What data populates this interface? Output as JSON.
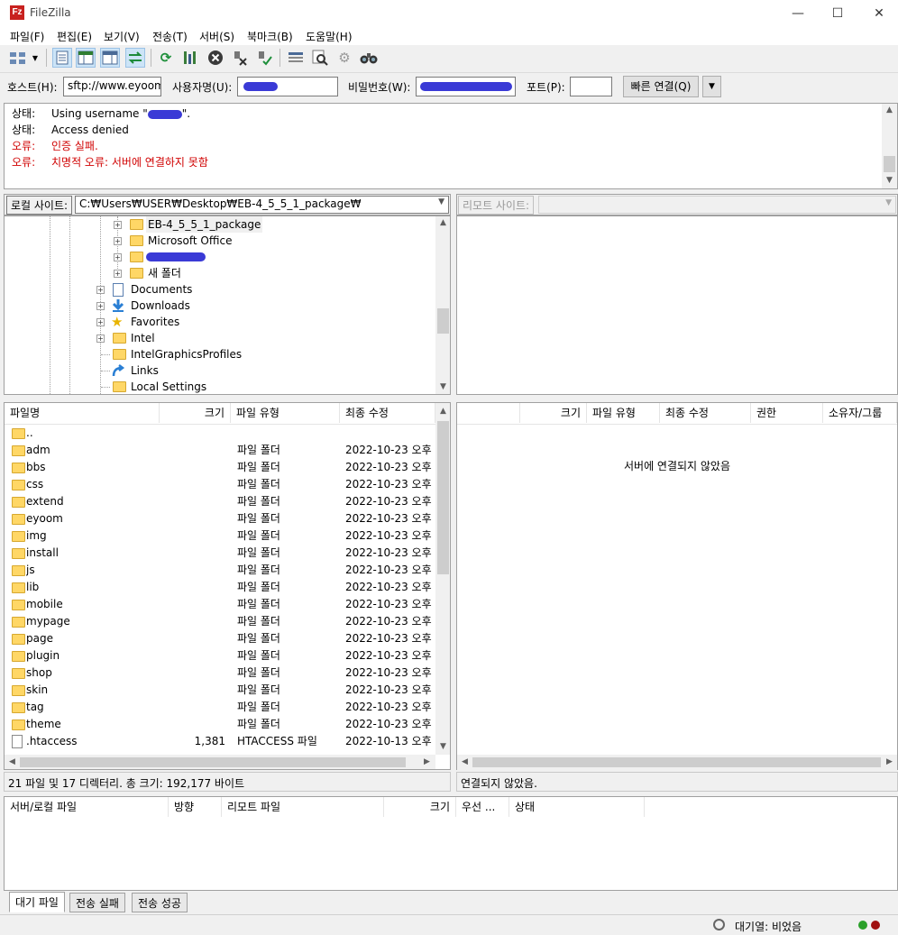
{
  "window": {
    "title": "FileZilla",
    "app_icon_label": "Fz",
    "minimize_glyph": "—",
    "maximize_glyph": "☐",
    "close_glyph": "✕"
  },
  "menu": [
    "파일(F)",
    "편집(E)",
    "보기(V)",
    "전송(T)",
    "서버(S)",
    "북마크(B)",
    "도움말(H)"
  ],
  "toolbar": {
    "icons": [
      "site-manager-icon",
      "chevron-down-icon",
      "message-log-toggle-icon",
      "local-tree-toggle-icon",
      "remote-tree-toggle-icon",
      "transfer-queue-toggle-icon",
      "refresh-icon",
      "process-queue-icon",
      "cancel-icon",
      "disconnect-icon",
      "reconnect-icon",
      "filter-icon",
      "compare-icon",
      "sync-browse-icon",
      "search-icon"
    ]
  },
  "quickconnect": {
    "host_label": "호스트(H):",
    "host_value": "sftp://www.eyoom",
    "user_label": "사용자명(U):",
    "pass_label": "비밀번호(W):",
    "port_label": "포트(P):",
    "port_value": "",
    "connect_label": "빠른 연결(Q)",
    "dropdown_glyph": "▼"
  },
  "log": [
    {
      "label": "상태:",
      "text": "Using username \"",
      "suffix": "\".",
      "type": "status"
    },
    {
      "label": "상태:",
      "text": "Access denied",
      "suffix": "",
      "type": "status"
    },
    {
      "label": "오류:",
      "text": "인증 실패.",
      "suffix": "",
      "type": "error"
    },
    {
      "label": "오류:",
      "text": "치명적 오류: 서버에 연결하지 못함",
      "suffix": "",
      "type": "error"
    }
  ],
  "local": {
    "site_label": "로컬 사이트:",
    "path": "C:₩Users₩USER₩Desktop₩EB-4_5_5_1_package₩",
    "tree": [
      {
        "label": "EB-4_5_5_1_package",
        "level": 2,
        "icon": "folder",
        "selected": true
      },
      {
        "label": "Microsoft Office",
        "level": 2,
        "icon": "folder"
      },
      {
        "label": "",
        "level": 2,
        "icon": "folder",
        "redacted": true
      },
      {
        "label": "새 폴더",
        "level": 2,
        "icon": "folder"
      },
      {
        "label": "Documents",
        "level": 1,
        "icon": "documents"
      },
      {
        "label": "Downloads",
        "level": 1,
        "icon": "downloads"
      },
      {
        "label": "Favorites",
        "level": 1,
        "icon": "favorites"
      },
      {
        "label": "Intel",
        "level": 1,
        "icon": "folder"
      },
      {
        "label": "IntelGraphicsProfiles",
        "level": 1,
        "icon": "folder",
        "no_expander": true
      },
      {
        "label": "Links",
        "level": 1,
        "icon": "links",
        "no_expander": true
      },
      {
        "label": "Local Settings",
        "level": 1,
        "icon": "folder",
        "no_expander": true
      }
    ],
    "columns": [
      "파일명",
      "크기",
      "파일 유형",
      "최종 수정"
    ],
    "files": [
      {
        "name": "..",
        "size": "",
        "type": "",
        "modified": "",
        "icon": "folder"
      },
      {
        "name": "adm",
        "size": "",
        "type": "파일 폴더",
        "modified": "2022-10-23 오후 ..",
        "icon": "folder"
      },
      {
        "name": "bbs",
        "size": "",
        "type": "파일 폴더",
        "modified": "2022-10-23 오후 ..",
        "icon": "folder"
      },
      {
        "name": "css",
        "size": "",
        "type": "파일 폴더",
        "modified": "2022-10-23 오후 ..",
        "icon": "folder"
      },
      {
        "name": "extend",
        "size": "",
        "type": "파일 폴더",
        "modified": "2022-10-23 오후 ..",
        "icon": "folder"
      },
      {
        "name": "eyoom",
        "size": "",
        "type": "파일 폴더",
        "modified": "2022-10-23 오후 ..",
        "icon": "folder"
      },
      {
        "name": "img",
        "size": "",
        "type": "파일 폴더",
        "modified": "2022-10-23 오후 ..",
        "icon": "folder"
      },
      {
        "name": "install",
        "size": "",
        "type": "파일 폴더",
        "modified": "2022-10-23 오후 ..",
        "icon": "folder"
      },
      {
        "name": "js",
        "size": "",
        "type": "파일 폴더",
        "modified": "2022-10-23 오후 ..",
        "icon": "folder"
      },
      {
        "name": "lib",
        "size": "",
        "type": "파일 폴더",
        "modified": "2022-10-23 오후 ..",
        "icon": "folder"
      },
      {
        "name": "mobile",
        "size": "",
        "type": "파일 폴더",
        "modified": "2022-10-23 오후 ..",
        "icon": "folder"
      },
      {
        "name": "mypage",
        "size": "",
        "type": "파일 폴더",
        "modified": "2022-10-23 오후 ..",
        "icon": "folder"
      },
      {
        "name": "page",
        "size": "",
        "type": "파일 폴더",
        "modified": "2022-10-23 오후 ..",
        "icon": "folder"
      },
      {
        "name": "plugin",
        "size": "",
        "type": "파일 폴더",
        "modified": "2022-10-23 오후 ..",
        "icon": "folder"
      },
      {
        "name": "shop",
        "size": "",
        "type": "파일 폴더",
        "modified": "2022-10-23 오후 ..",
        "icon": "folder"
      },
      {
        "name": "skin",
        "size": "",
        "type": "파일 폴더",
        "modified": "2022-10-23 오후 ..",
        "icon": "folder"
      },
      {
        "name": "tag",
        "size": "",
        "type": "파일 폴더",
        "modified": "2022-10-23 오후 ..",
        "icon": "folder"
      },
      {
        "name": "theme",
        "size": "",
        "type": "파일 폴더",
        "modified": "2022-10-23 오후 ..",
        "icon": "folder"
      },
      {
        "name": ".htaccess",
        "size": "1,381",
        "type": "HTACCESS 파일",
        "modified": "2022-10-13 오후 ..",
        "icon": "file"
      }
    ],
    "status": "21 파일 및 17 디렉터리. 총 크기: 192,177 바이트"
  },
  "remote": {
    "site_label": "리모트 사이트:",
    "path": "",
    "columns": [
      "크기",
      "파일 유형",
      "최종 수정",
      "권한",
      "소유자/그룹"
    ],
    "empty_message": "서버에 연결되지 않았음",
    "status": "연결되지 않았음."
  },
  "queue": {
    "columns": [
      "서버/로컬 파일",
      "방향",
      "리모트 파일",
      "크기",
      "우선 ...",
      "상태"
    ],
    "tabs": [
      "대기 파일",
      "전송 실패",
      "전송 성공"
    ],
    "status": "대기열: 비었음"
  },
  "colors": {
    "error": "#d00000",
    "folder": "#ffd766",
    "redaction": "#3a3ad6"
  }
}
